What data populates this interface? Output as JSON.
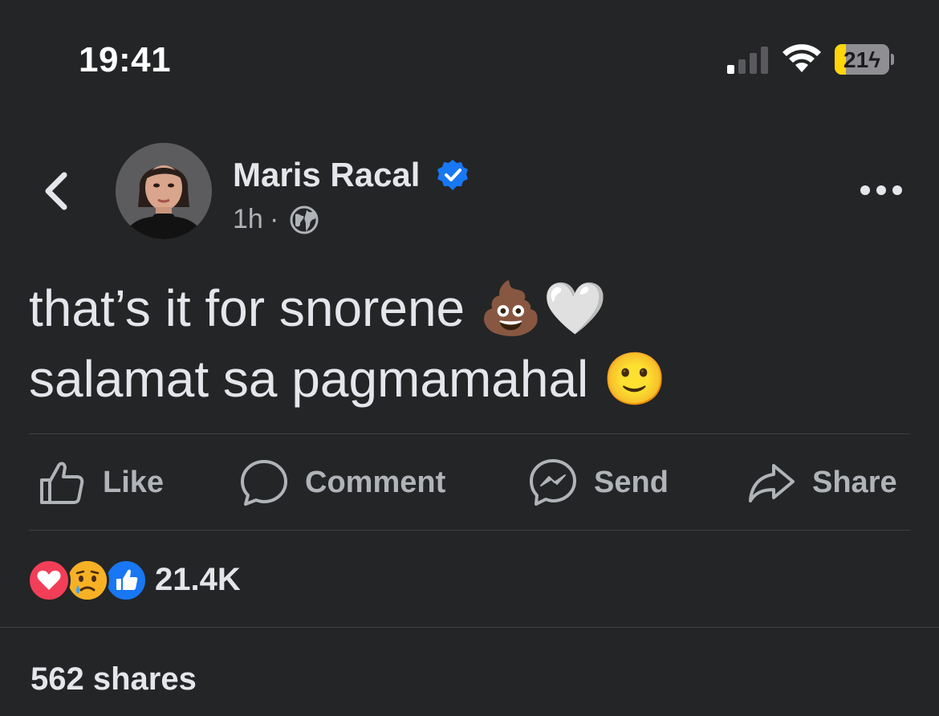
{
  "status_bar": {
    "time": "19:41",
    "battery_level": "21",
    "battery_fraction": 0.21,
    "charging": true,
    "signal_bars": 1,
    "signal_bars_total": 4
  },
  "post": {
    "author": "Maris Racal",
    "verified": true,
    "timestamp": "1h",
    "separator": "·",
    "audience_icon": "globe-icon",
    "text_lines": [
      "that’s it for snorene 💩🤍",
      "salamat sa pagmamahal 🙂"
    ]
  },
  "actions": {
    "like_label": "Like",
    "comment_label": "Comment",
    "send_label": "Send",
    "share_label": "Share"
  },
  "reactions": {
    "icons": [
      "love-reaction-icon",
      "sad-reaction-icon",
      "like-reaction-icon"
    ],
    "count": "21.4K"
  },
  "shares_text": "562 shares",
  "colors": {
    "background": "#242526",
    "text": "#e4e6eb",
    "secondary_text": "#b0b3b8",
    "verified_blue": "#1877f2",
    "love_red": "#f33e58",
    "battery_yellow": "#ffd60a"
  }
}
